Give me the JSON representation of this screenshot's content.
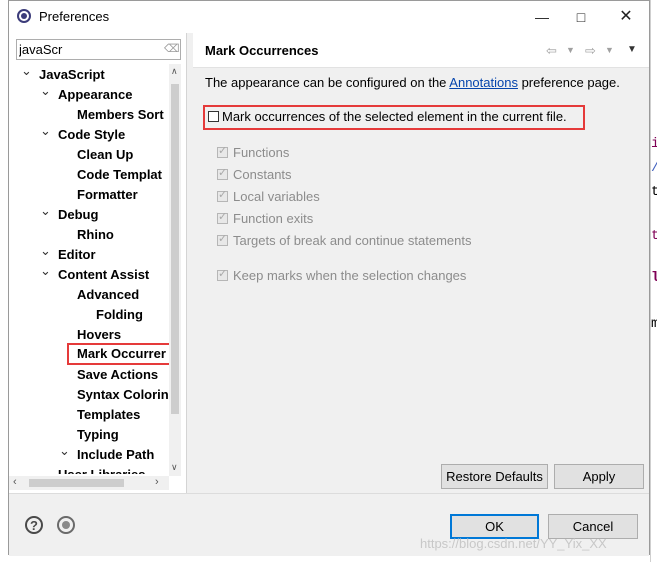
{
  "window": {
    "title": "Preferences"
  },
  "filter": {
    "value": "javaScr"
  },
  "tree": [
    {
      "label": "JavaScript",
      "expanded": true
    },
    {
      "label": "Appearance",
      "expanded": true
    },
    {
      "label": "Members Sort"
    },
    {
      "label": "Code Style",
      "expanded": true
    },
    {
      "label": "Clean Up"
    },
    {
      "label": "Code Templat"
    },
    {
      "label": "Formatter"
    },
    {
      "label": "Debug",
      "expanded": true
    },
    {
      "label": "Rhino"
    },
    {
      "label": "Editor",
      "expanded": true
    },
    {
      "label": "Content Assist",
      "expanded": true
    },
    {
      "label": "Advanced"
    },
    {
      "label": "Folding"
    },
    {
      "label": "Hovers"
    },
    {
      "label": "Mark Occurrer",
      "selected": true
    },
    {
      "label": "Save Actions"
    },
    {
      "label": "Syntax Colorin"
    },
    {
      "label": "Templates"
    },
    {
      "label": "Typing"
    },
    {
      "label": "Include Path",
      "expanded": true
    },
    {
      "label": "User Libraries"
    }
  ],
  "page": {
    "title": "Mark Occurrences",
    "description_before": "The appearance can be configured on the ",
    "description_link": "Annotations",
    "description_after": " preference page.",
    "main_option": "Mark occurrences of the selected element in the current file.",
    "main_checked": false,
    "options": [
      {
        "label": "Functions",
        "checked": true
      },
      {
        "label": "Constants",
        "checked": true
      },
      {
        "label": "Local variables",
        "checked": true
      },
      {
        "label": "Function exits",
        "checked": true
      },
      {
        "label": "Targets of break and continue statements",
        "checked": true
      }
    ],
    "keep_marks": {
      "label": "Keep marks when the selection changes",
      "checked": true
    }
  },
  "buttons": {
    "restore": "Restore Defaults",
    "apply": "Apply",
    "ok": "OK",
    "cancel": "Cancel"
  },
  "icons": {
    "help": "?",
    "back": "⇦",
    "forward": "⇨"
  },
  "watermark": "https://blog.csdn.net/YY_Yix_XX",
  "colors": {
    "highlight": "#e53a3a",
    "link": "#0645ad",
    "accent": "#0078d7"
  }
}
